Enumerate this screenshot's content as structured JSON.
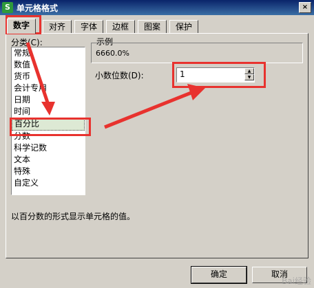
{
  "window": {
    "title": "单元格格式",
    "app_icon": "S",
    "close": "×"
  },
  "tabs": [
    "数字",
    "对齐",
    "字体",
    "边框",
    "图案",
    "保护"
  ],
  "category": {
    "label": "分类(C):",
    "items": [
      "常规",
      "数值",
      "货币",
      "会计专用",
      "日期",
      "时间",
      "百分比",
      "分数",
      "科学记数",
      "文本",
      "特殊",
      "自定义"
    ],
    "selected": "百分比"
  },
  "sample": {
    "label": "示例",
    "value": "6660.0%"
  },
  "decimals": {
    "label": "小数位数(D):",
    "value": "1"
  },
  "description": "以百分数的形式显示单元格的值。",
  "buttons": {
    "ok": "确定",
    "cancel": "取消"
  },
  "watermark": "Bai经验",
  "colors": {
    "highlight": "#e8322e",
    "title_bar": "#0a246a",
    "selected_item": "#dde9d4"
  }
}
